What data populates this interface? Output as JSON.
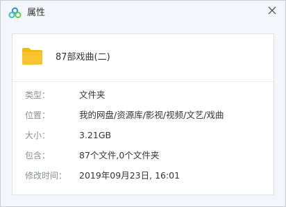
{
  "window": {
    "title": "属性",
    "app_icon": "baidu-netdisk-logo",
    "close_icon": "close-icon"
  },
  "file": {
    "icon": "folder-icon",
    "name": "87部戏曲(二)"
  },
  "properties": [
    {
      "key": "type",
      "label": "类型：",
      "value": "文件夹"
    },
    {
      "key": "location",
      "label": "位置：",
      "value": "我的网盘/资源库/影视/视频/文艺/戏曲"
    },
    {
      "key": "size",
      "label": "大小：",
      "value": "3.21GB"
    },
    {
      "key": "contents",
      "label": "包含：",
      "value": "87个文件,0个文件夹"
    },
    {
      "key": "modified",
      "label": "修改时间：",
      "value": "2019年09月23日, 16:01"
    }
  ],
  "colors": {
    "folder": "#f7c32e",
    "logo_blue": "#2f88ff",
    "logo_teal": "#35c3c8",
    "logo_green": "#6ccb4a"
  }
}
